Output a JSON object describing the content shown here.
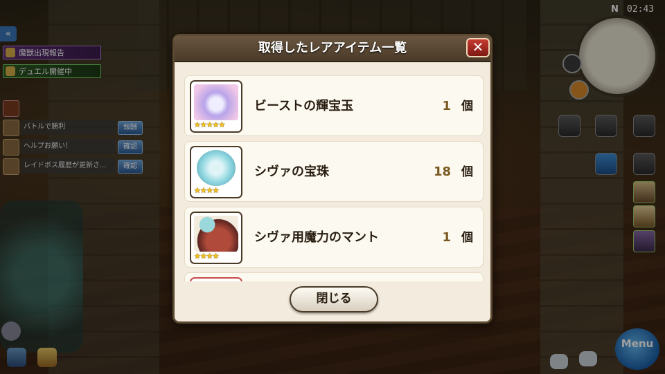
{
  "status_bar": {
    "compass": "N",
    "time": "02:43"
  },
  "left_hud": {
    "back_glyph": "«",
    "event_banners": [
      {
        "label": "魔獣出現報告",
        "color": "purple"
      },
      {
        "label": "デュエル開催中",
        "color": "green"
      }
    ],
    "missions": [
      {
        "text": "バトルで勝利",
        "button": "報酬"
      },
      {
        "text": "ヘルプお願い！",
        "button": "確認"
      },
      {
        "text": "レイドボス履歴が更新さ...",
        "button": "確認"
      }
    ]
  },
  "dialog": {
    "title": "取得したレアアイテム一覧",
    "close_glyph": "✕",
    "items": [
      {
        "name": "ビーストの輝宝玉",
        "count": "1",
        "unit": "個",
        "rarity": 5,
        "stars": "★★★★★",
        "art_color": "#b8a4e8"
      },
      {
        "name": "シヴァの宝珠",
        "count": "18",
        "unit": "個",
        "rarity": 4,
        "stars": "★★★★",
        "art_color": "#8fd6e0"
      },
      {
        "name": "シヴァ用魔力のマント",
        "count": "1",
        "unit": "個",
        "rarity": 4,
        "stars": "★★★★",
        "art_color": "#b04a3a"
      }
    ],
    "close_button": "閉じる"
  },
  "right_hud": {
    "menu_label": "Menu"
  },
  "colors": {
    "dialog_bg": "#f3ecde",
    "header_bg": "#5a4834",
    "close_red": "#c53a30",
    "star": "#f3c21c",
    "qty_text": "#7a5a22"
  }
}
